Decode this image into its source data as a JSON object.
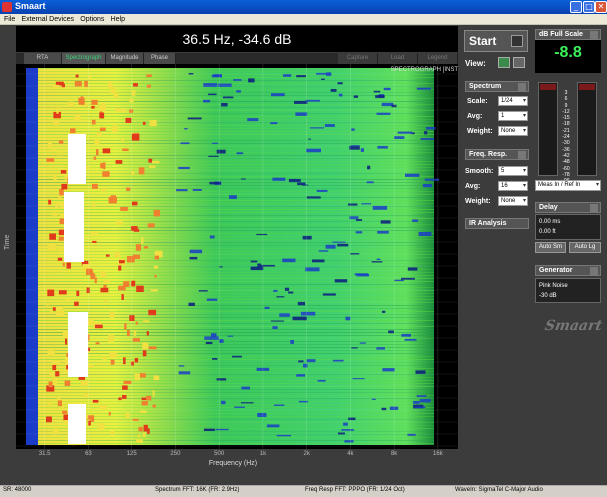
{
  "window": {
    "title": "Smaart",
    "buttons": [
      "_",
      "□",
      "✕"
    ]
  },
  "menu": [
    "File",
    "External Devices",
    "Options",
    "Help"
  ],
  "readout": "36.5 Hz, -34.6 dB",
  "tabs": [
    {
      "label": "RTA",
      "state": "normal"
    },
    {
      "label": "Spectrograph",
      "state": "active"
    },
    {
      "label": "Magnitude",
      "state": "normal"
    },
    {
      "label": "Phase",
      "state": "normal"
    },
    {
      "label": "Capture",
      "state": "dim"
    },
    {
      "label": "Load",
      "state": "dim"
    },
    {
      "label": "Legend",
      "state": "dim"
    }
  ],
  "plot": {
    "overlay_label": "SPECTROGRAPH [INST",
    "y_axis_label": "Time",
    "x_axis_label": "Frequency (Hz)",
    "x_ticks": [
      "31.5",
      "63",
      "125",
      "250",
      "500",
      "1k",
      "2k",
      "4k",
      "8k",
      "16k"
    ],
    "colors": {
      "background": "#000000",
      "low": "#1a3cc8",
      "mid": "#3cc85a",
      "high": "#f0e040",
      "peak": "#e03a1a",
      "max": "#ffffff"
    }
  },
  "controls": {
    "start_label": "Start",
    "view_label": "View:",
    "spectrum": {
      "title": "Spectrum",
      "scale_label": "Scale:",
      "scale_value": "1/24",
      "avg_label": "Avg:",
      "avg_value": "1",
      "weight_label": "Weight:",
      "weight_value": "None"
    },
    "freq_resp": {
      "title": "Freq. Resp.",
      "smooth_label": "Smooth:",
      "smooth_value": "5",
      "avg_label": "Avg:",
      "avg_value": "16",
      "weight_label": "Weight:",
      "weight_value": "None"
    },
    "ir_label": "IR Analysis"
  },
  "meters": {
    "title": "dB Full Scale",
    "value": "-8.8",
    "scale": [
      "3",
      "6",
      "9",
      "-12",
      "-15",
      "-18",
      "-21",
      "-24",
      "-30",
      "-36",
      "-42",
      "-48",
      "-60",
      "-78",
      "-96"
    ],
    "select_value": "Meas In / Ref In"
  },
  "delay": {
    "title": "Delay",
    "ms": "0.00 ms",
    "ft": "0.00 ft",
    "auto_sm": "Auto Sm",
    "auto_lg": "Auto Lg"
  },
  "generator": {
    "title": "Generator",
    "type": "Pink Noise",
    "level": "-30 dB"
  },
  "logo_text": "Smaart",
  "status": {
    "sr": "SR: 48000",
    "spectrum_fft": "Spectrum FFT: 16K (FR: 2.9Hz)",
    "freq_fft": "Freq Resp FFT: PPPO (FR: 1/24 Oct)",
    "wavein": "WaveIn: SigmaTel C-Major Audio"
  }
}
